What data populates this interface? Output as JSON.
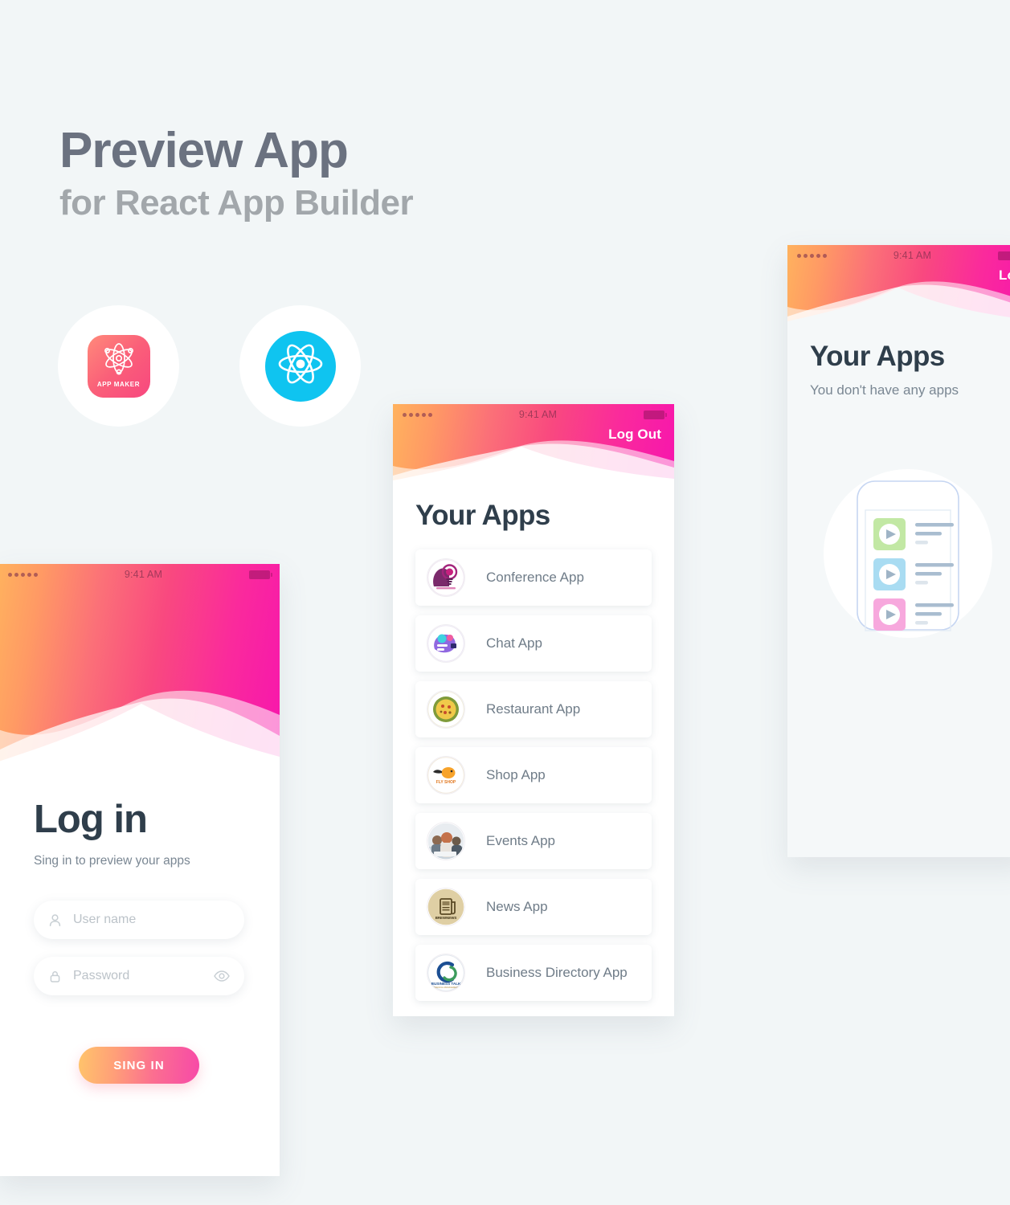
{
  "page": {
    "background_color": "#f2f6f7",
    "headline": "Preview App",
    "subheadline": "for React App Builder"
  },
  "logos": [
    {
      "name": "app-maker-logo",
      "label": "APP MAKER",
      "gradient_from": "#ff8a7a",
      "gradient_to": "#f8477f"
    },
    {
      "name": "react-logo",
      "label": "",
      "color": "#0fc4f0"
    }
  ],
  "login_screen": {
    "statusbar": {
      "time": "9:41 AM",
      "signal_dots": 5
    },
    "title": "Log in",
    "subtitle": "Sing in to preview your apps",
    "username_field": {
      "placeholder": "User name",
      "value": "",
      "icon": "user-icon"
    },
    "password_field": {
      "placeholder": "Password",
      "value": "",
      "icon": "lock-icon",
      "toggle_icon": "eye-icon"
    },
    "submit_button": "SING IN",
    "header_gradient_from": "#ffb25e",
    "header_gradient_to": "#f716ad"
  },
  "apps_screen": {
    "statusbar": {
      "time": "9:41 AM",
      "signal_dots": 5
    },
    "logout_label": "Log Out",
    "title": "Your Apps",
    "apps": [
      {
        "name": "Conference App",
        "icon": "conference-app-icon"
      },
      {
        "name": "Chat App",
        "icon": "chat-app-icon"
      },
      {
        "name": "Restaurant App",
        "icon": "restaurant-app-icon"
      },
      {
        "name": "Shop App",
        "icon": "shop-app-icon"
      },
      {
        "name": "Events App",
        "icon": "events-app-icon"
      },
      {
        "name": "News App",
        "icon": "news-app-icon"
      },
      {
        "name": "Business Directory App",
        "icon": "business-directory-app-icon"
      }
    ]
  },
  "empty_screen": {
    "statusbar": {
      "time": "9:41 AM",
      "signal_dots": 5
    },
    "logout_label": "Lo",
    "title": "Your Apps",
    "subtitle": "You don't have any apps",
    "illustration": {
      "name": "empty-apps-illustration",
      "tiles": [
        {
          "color": "#c2e8a4",
          "icon": "play-icon"
        },
        {
          "color": "#a9dcf2",
          "icon": "play-icon"
        },
        {
          "color": "#f7a8dd",
          "icon": "play-icon"
        }
      ]
    }
  }
}
